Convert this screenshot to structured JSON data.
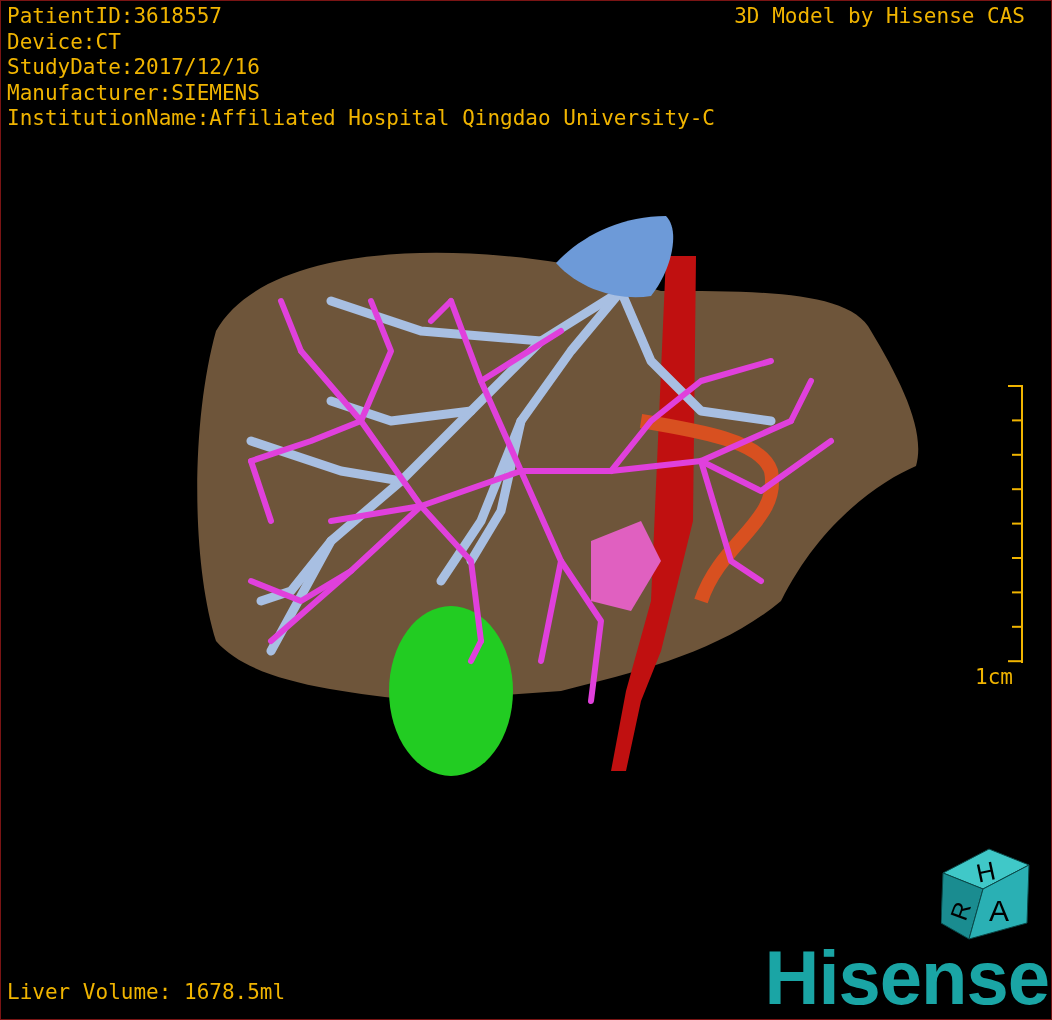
{
  "patient_info": [
    "PatientID:3618557",
    "Device:CT",
    "StudyDate:2017/12/16",
    "Manufacturer:SIEMENS",
    "InstitutionName:Affiliated Hospital Qingdao University-C"
  ],
  "model_credit": "3D Model by Hisense CAS",
  "scale_bar": {
    "label": "1cm"
  },
  "orientation_cube": {
    "top": "H",
    "left": "R",
    "front": "A"
  },
  "liver_volume": "Liver Volume: 1678.5ml",
  "logo": "Hisense"
}
